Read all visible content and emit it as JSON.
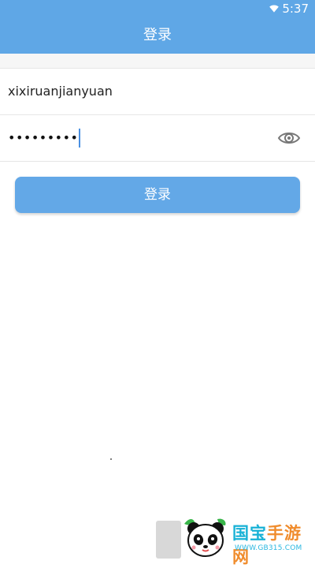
{
  "status_bar": {
    "time": "5:37",
    "wifi_icon": "wifi-icon"
  },
  "app_bar": {
    "title": "登录"
  },
  "form": {
    "username_value": "xixiruanjianyuan",
    "password_masked": "•••••••••",
    "eye_icon": "eye-icon"
  },
  "actions": {
    "login_label": "登录"
  },
  "watermark": {
    "brand_part1": "国宝",
    "brand_part2": "手游网",
    "site": "WWW.GB315.COM"
  },
  "colors": {
    "accent": "#5fa7e6",
    "button": "#63a8e7",
    "divider": "#e6e6e6"
  }
}
